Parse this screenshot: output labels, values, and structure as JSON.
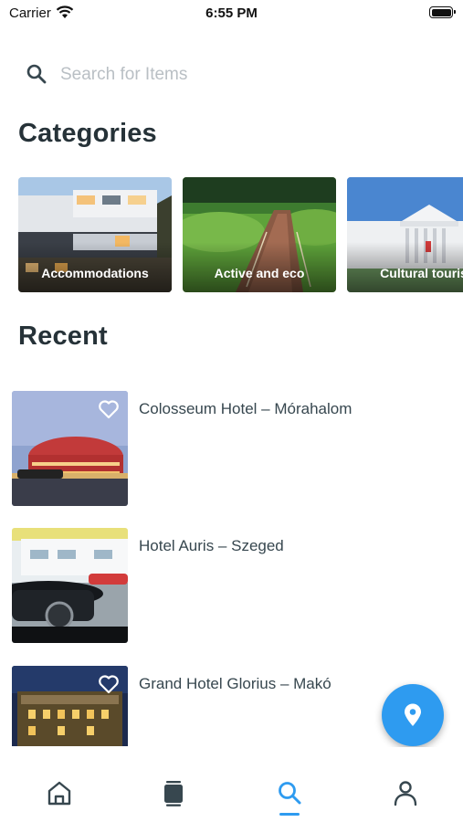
{
  "status_bar": {
    "carrier": "Carrier",
    "time": "6:55 PM",
    "icons": [
      "wifi-icon",
      "battery-icon"
    ]
  },
  "search": {
    "placeholder": "Search for Items",
    "value": ""
  },
  "categories": {
    "title": "Categories",
    "items": [
      {
        "label": "Accommodations"
      },
      {
        "label": "Active and eco"
      },
      {
        "label": "Cultural touris"
      }
    ]
  },
  "recent": {
    "title": "Recent",
    "items": [
      {
        "title": "Colosseum Hotel – Mórahalom",
        "favorite_icon": "heart-outline-icon"
      },
      {
        "title": "Hotel Auris – Szeged",
        "favorite_icon": ""
      },
      {
        "title": "Grand Hotel Glorius – Makó",
        "favorite_icon": "heart-outline-icon"
      }
    ]
  },
  "fab": {
    "icon": "map-pin-icon"
  },
  "bottom_nav": {
    "items": [
      {
        "icon": "home-icon",
        "active": false
      },
      {
        "icon": "cards-icon",
        "active": false
      },
      {
        "icon": "search-icon",
        "active": true
      },
      {
        "icon": "profile-icon",
        "active": false
      }
    ]
  },
  "colors": {
    "accent": "#2e9bf0",
    "text_primary": "#263238",
    "placeholder": "#b9bfc4"
  }
}
